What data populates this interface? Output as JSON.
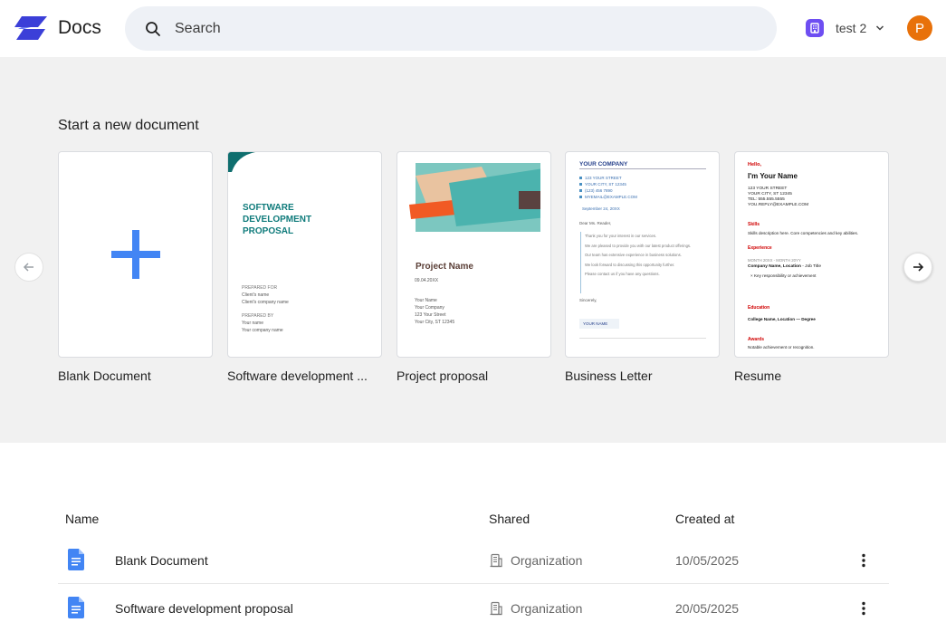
{
  "header": {
    "app_name": "Docs",
    "search_placeholder": "Search",
    "workspace_name": "test 2",
    "avatar_initial": "P"
  },
  "templates": {
    "title": "Start a new document",
    "items": [
      {
        "label": "Blank Document"
      },
      {
        "label": "Software development ...",
        "heading": [
          "SOFTWARE",
          "DEVELOPMENT",
          "PROPOSAL"
        ],
        "prepared_for": "PREPARED FOR",
        "client_name": "Client's name",
        "client_company": "Client's company name",
        "prepared_by": "PREPARED BY",
        "your_name": "Your name",
        "your_company": "Your company name"
      },
      {
        "label": "Project proposal",
        "project_name": "Project Name",
        "date": "09.04.20XX",
        "lines": [
          "Your Name",
          "Your Company",
          "123 Your Street",
          "Your City, ST 12345"
        ]
      },
      {
        "label": "Business Letter",
        "company": "YOUR COMPANY",
        "address": [
          "123 YOUR STREET",
          "YOUR CITY, ST 12345",
          "(123) 456 7890",
          "MYEMAIL@EXAMPLE.COM"
        ],
        "date": "September 24, 20XX",
        "salutation": "Dear Ms. Reader,",
        "body": [
          "Thank you for your interest in our services.",
          "We are pleased to provide you with our latest product offerings.",
          "Our team has extensive experience in business solutions.",
          "We look forward to discussing this opportunity further.",
          "Please contact us if you have any questions."
        ],
        "closing": "Sincerely,",
        "signature": "YOUR NAME"
      },
      {
        "label": "Resume",
        "hello": "Hello,",
        "name": "I'm Your Name",
        "contact": [
          "123 YOUR STREET",
          "YOUR CITY, ST 12345",
          "TEL: 555.555.5555",
          "YOU.REPLY@EXAMPLE.COM"
        ],
        "skills_h": "Skills",
        "skills": "Skills description here. Core competencies and key abilities.",
        "experience_h": "Experience",
        "exp_dates": "MONTH 20XX - MONTH 20YY",
        "exp_company": "Company Name, Location",
        "exp_title": "- Job Title",
        "exp_point": "Key responsibility or achievement",
        "education_h": "Education",
        "education": "College Name, Location — Degree",
        "awards_h": "Awards",
        "awards": "Notable achievement or recognition."
      }
    ]
  },
  "documents": {
    "columns": {
      "name": "Name",
      "shared": "Shared",
      "created": "Created at"
    },
    "rows": [
      {
        "name": "Blank Document",
        "shared": "Organization",
        "created": "10/05/2025"
      },
      {
        "name": "Software development proposal",
        "shared": "Organization",
        "created": "20/05/2025"
      }
    ]
  },
  "colors": {
    "accent": "#4285f4",
    "logo": "#3b3fd8",
    "teal": "#0f7b7b",
    "avatar": "#e8710a"
  }
}
